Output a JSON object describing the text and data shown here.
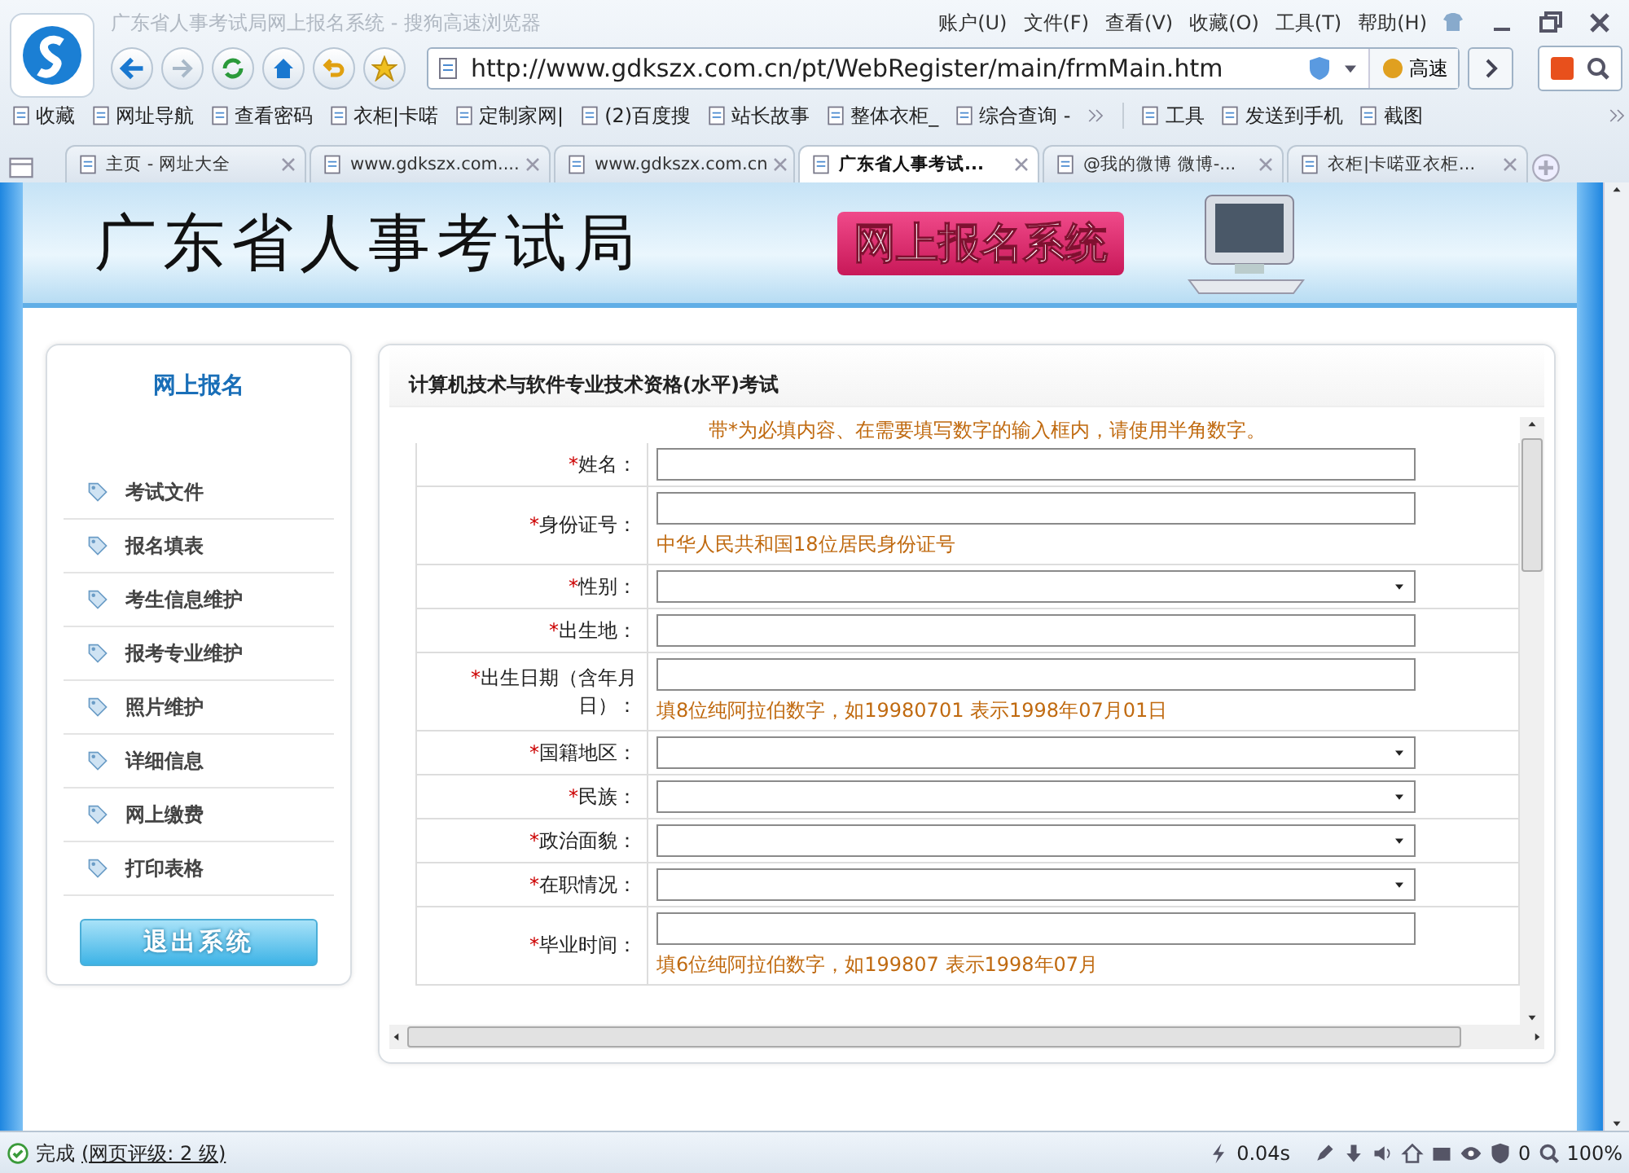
{
  "window": {
    "title": "广东省人事考试局网上报名系统 - 搜狗高速浏览器"
  },
  "menu": [
    "账户(U)",
    "文件(F)",
    "查看(V)",
    "收藏(O)",
    "工具(T)",
    "帮助(H)"
  ],
  "address_bar": {
    "url": "http://www.gdkszx.com.cn/pt/WebRegister/main/frmMain.htm",
    "speed_button": "高速"
  },
  "bookmarks": [
    {
      "label": "收藏"
    },
    {
      "label": "网址导航"
    },
    {
      "label": "查看密码"
    },
    {
      "label": "衣柜|卡喏"
    },
    {
      "label": "定制家网|"
    },
    {
      "label": "(2)百度搜"
    },
    {
      "label": "站长故事"
    },
    {
      "label": "整体衣柜_"
    },
    {
      "label": "综合查询 -"
    }
  ],
  "tools": [
    {
      "label": "工具"
    },
    {
      "label": "发送到手机"
    },
    {
      "label": "截图"
    }
  ],
  "tabs": [
    {
      "title": "主页 - 网址大全",
      "selected": false
    },
    {
      "title": "www.gdkszx.com....",
      "selected": false
    },
    {
      "title": "www.gdkszx.com.cn",
      "selected": false
    },
    {
      "title": "广东省人事考试...",
      "selected": true
    },
    {
      "title": "@我的微博 微博-...",
      "selected": false
    },
    {
      "title": "衣柜|卡喏亚衣柜...",
      "selected": false
    }
  ],
  "banner": {
    "title": "广东省人事考试局",
    "system": "网上报名系统"
  },
  "sidebar": {
    "title": "网上报名",
    "items": [
      "考试文件",
      "报名填表",
      "考生信息维护",
      "报考专业维护",
      "照片维护",
      "详细信息",
      "网上缴费",
      "打印表格"
    ],
    "exit_button": "退出系统"
  },
  "form": {
    "title": "计算机技术与软件专业技术资格(水平)考试",
    "note": "带*为必填内容、在需要填写数字的输入框内，请使用半角数字。",
    "rows": [
      {
        "mark": "*",
        "label": "姓名：",
        "kind": "text"
      },
      {
        "mark": "*",
        "label": "身份证号：",
        "kind": "text",
        "hint": "中华人民共和国18位居民身份证号"
      },
      {
        "mark": "*",
        "label": "性别：",
        "kind": "select"
      },
      {
        "mark": "*",
        "label": "出生地：",
        "kind": "text"
      },
      {
        "mark": "*",
        "label": "出生日期（含年月日）：",
        "kind": "text",
        "hint": "填8位纯阿拉伯数字，如19980701 表示1998年07月01日"
      },
      {
        "mark": "*",
        "label": "国籍地区：",
        "kind": "select"
      },
      {
        "mark": "*",
        "label": "民族：",
        "kind": "select"
      },
      {
        "mark": "*",
        "label": "政治面貌：",
        "kind": "select"
      },
      {
        "mark": "*",
        "label": "在职情况：",
        "kind": "select"
      },
      {
        "mark": "*",
        "label": "毕业时间：",
        "kind": "text",
        "hint": "填6位纯阿拉伯数字，如199807 表示1998年07月"
      }
    ]
  },
  "status_bar": {
    "status": "完成",
    "rating": "(网页评级: 2 级)",
    "load_time": "0.04s",
    "blocked_count": "0",
    "zoom": "100%"
  }
}
